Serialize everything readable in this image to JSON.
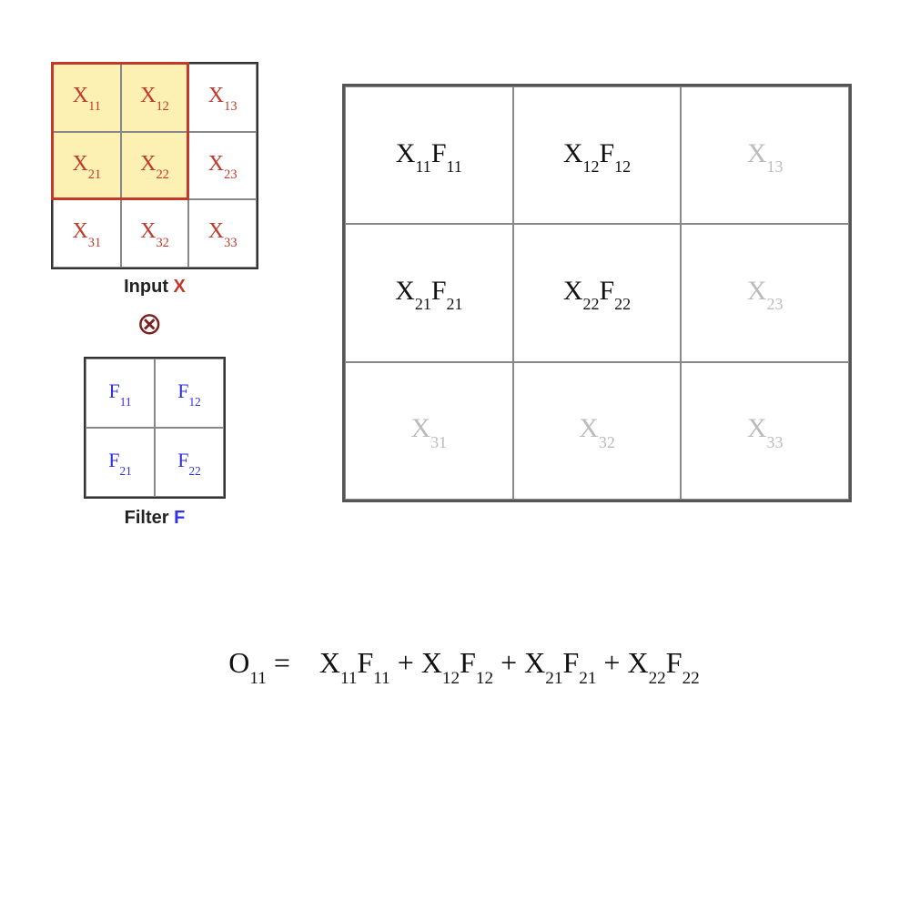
{
  "input": {
    "label_prefix": "Input ",
    "label_x": "X",
    "cells": [
      {
        "base": "X",
        "sub": "11",
        "highlight": true
      },
      {
        "base": "X",
        "sub": "12",
        "highlight": true
      },
      {
        "base": "X",
        "sub": "13",
        "highlight": false
      },
      {
        "base": "X",
        "sub": "21",
        "highlight": true
      },
      {
        "base": "X",
        "sub": "22",
        "highlight": true
      },
      {
        "base": "X",
        "sub": "23",
        "highlight": false
      },
      {
        "base": "X",
        "sub": "31",
        "highlight": false
      },
      {
        "base": "X",
        "sub": "32",
        "highlight": false
      },
      {
        "base": "X",
        "sub": "33",
        "highlight": false
      }
    ]
  },
  "operator": "⊗",
  "filter": {
    "label_prefix": "Filter ",
    "label_f": "F",
    "cells": [
      {
        "base": "F",
        "sub": "11"
      },
      {
        "base": "F",
        "sub": "12"
      },
      {
        "base": "F",
        "sub": "21"
      },
      {
        "base": "F",
        "sub": "22"
      }
    ]
  },
  "big": {
    "cells": [
      {
        "xb": "X",
        "xs": "11",
        "fb": "F",
        "fs": "11",
        "dim": false
      },
      {
        "xb": "X",
        "xs": "12",
        "fb": "F",
        "fs": "12",
        "dim": false
      },
      {
        "xb": "X",
        "xs": "13",
        "fb": "",
        "fs": "",
        "dim": true
      },
      {
        "xb": "X",
        "xs": "21",
        "fb": "F",
        "fs": "21",
        "dim": false
      },
      {
        "xb": "X",
        "xs": "22",
        "fb": "F",
        "fs": "22",
        "dim": false
      },
      {
        "xb": "X",
        "xs": "23",
        "fb": "",
        "fs": "",
        "dim": true
      },
      {
        "xb": "X",
        "xs": "31",
        "fb": "",
        "fs": "",
        "dim": true
      },
      {
        "xb": "X",
        "xs": "32",
        "fb": "",
        "fs": "",
        "dim": true
      },
      {
        "xb": "X",
        "xs": "33",
        "fb": "",
        "fs": "",
        "dim": true
      }
    ]
  },
  "equation": {
    "lhs_base": "O",
    "lhs_sub": "11",
    "eq": " = ",
    "plus": " + ",
    "terms": [
      {
        "xb": "X",
        "xs": "11",
        "fb": "F",
        "fs": "11"
      },
      {
        "xb": "X",
        "xs": "12",
        "fb": "F",
        "fs": "12"
      },
      {
        "xb": "X",
        "xs": "21",
        "fb": "F",
        "fs": "21"
      },
      {
        "xb": "X",
        "xs": "22",
        "fb": "F",
        "fs": "22"
      }
    ]
  }
}
